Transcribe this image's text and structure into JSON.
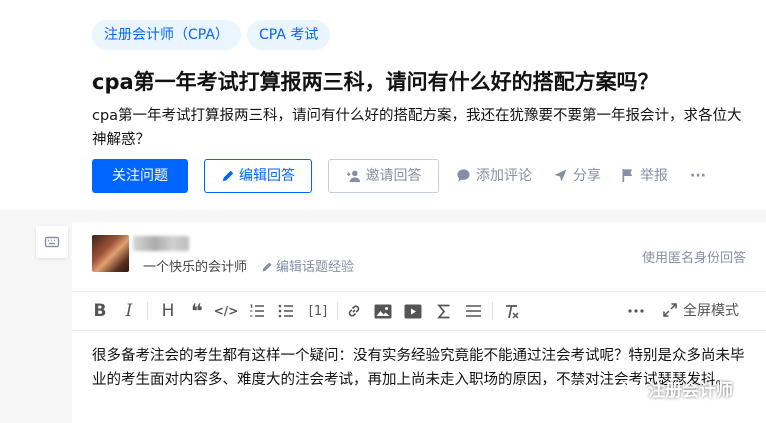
{
  "question": {
    "topics": [
      "注册会计师（CPA）",
      "CPA 考试"
    ],
    "title": "cpa第一年考试打算报两三科，请问有什么好的搭配方案吗？",
    "description": "cpa第一年考试打算报两三科，请问有什么好的搭配方案，我还在犹豫要不要第一年报会计，求各位大神解惑？",
    "actions": {
      "follow": "关注问题",
      "edit_answer": "编辑回答",
      "invite": "邀请回答",
      "comment": "添加评论",
      "share": "分享",
      "report": "举报",
      "more": "···"
    }
  },
  "answer": {
    "user_bio": "一个快乐的会计师",
    "edit_experience": "编辑话题经验",
    "anonymous": "使用匿名身份回答",
    "toolbar": {
      "bold": "B",
      "italic": "I",
      "heading": "H",
      "quote": "❝",
      "code": "</>",
      "numbered_list": "⋮≡",
      "bulleted_list": "•≡",
      "reference": "[1]",
      "fullscreen": "全屏模式"
    },
    "content": "很多备考注会的考生都有这样一个疑问：没有实务经验究竟能不能通过注会考试呢？特别是众多尚未毕业的考生面对内容多、难度大的注会考试，再加上尚未走入职场的原因，不禁对注会考试瑟瑟发抖。"
  },
  "watermark": "注册会计师",
  "colors": {
    "primary": "#0066ff",
    "muted": "#8590a6",
    "tag_bg": "#ebf5ff"
  }
}
